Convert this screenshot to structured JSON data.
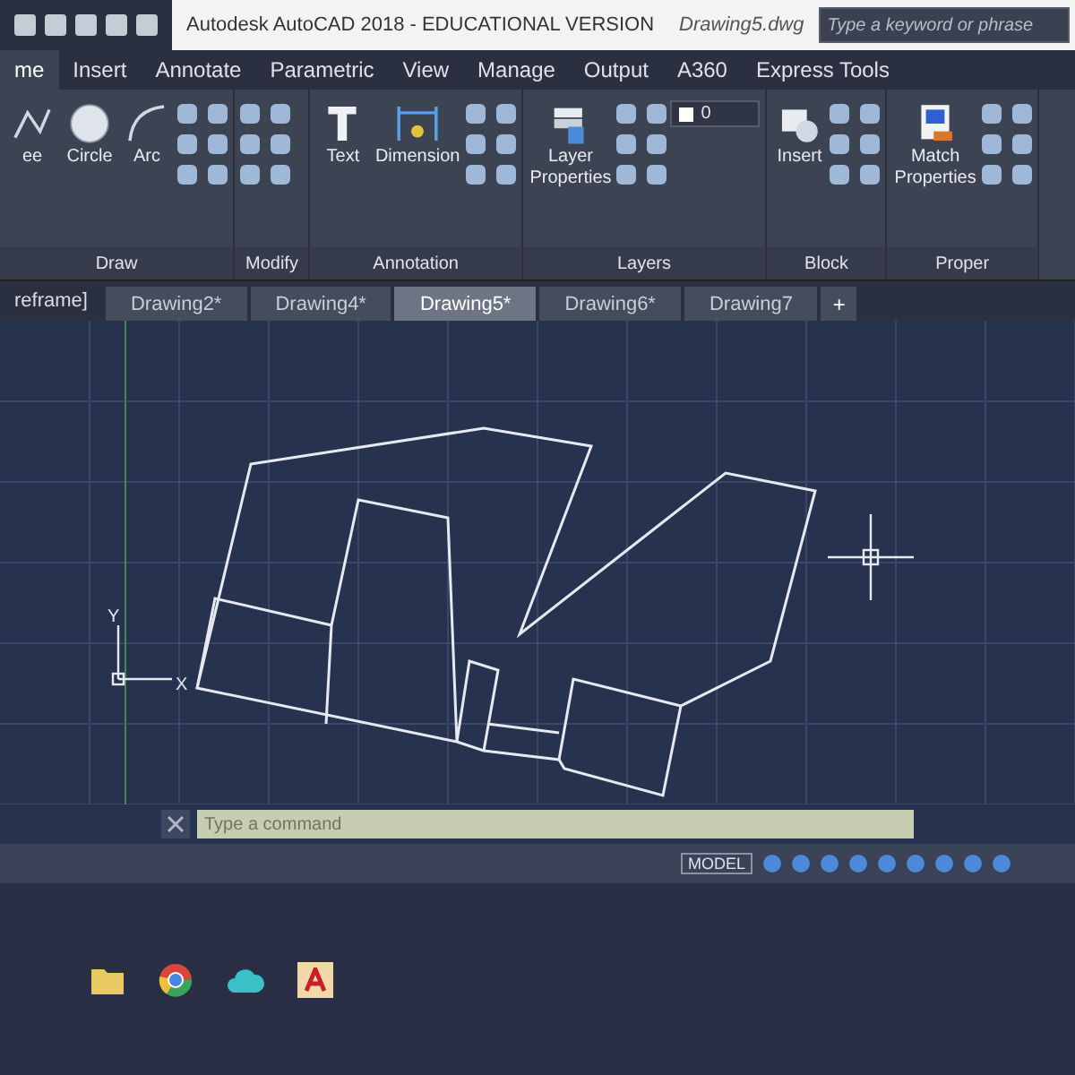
{
  "title_bar": {
    "title": "Autodesk AutoCAD 2018 - EDUCATIONAL VERSION",
    "file": "Drawing5.dwg",
    "search": {
      "placeholder": "Type a keyword or phrase"
    }
  },
  "ribbon_tabs": [
    {
      "label": "me",
      "selected": true
    },
    {
      "label": "Insert",
      "selected": false
    },
    {
      "label": "Annotate",
      "selected": false
    },
    {
      "label": "Parametric",
      "selected": false
    },
    {
      "label": "View",
      "selected": false
    },
    {
      "label": "Manage",
      "selected": false
    },
    {
      "label": "Output",
      "selected": false
    },
    {
      "label": "A360",
      "selected": false
    },
    {
      "label": "Express Tools",
      "selected": false
    }
  ],
  "panels": [
    {
      "title": "Draw",
      "tools": [
        {
          "label": "ee",
          "kind": "polyline"
        },
        {
          "label": "Circle",
          "kind": "circle"
        },
        {
          "label": "Arc",
          "kind": "arc"
        }
      ]
    },
    {
      "title": "Modify"
    },
    {
      "title": "Annotation",
      "tools": [
        {
          "label": "Text",
          "kind": "text"
        },
        {
          "label": "Dimension",
          "kind": "dimension"
        }
      ]
    },
    {
      "title": "Layers",
      "tools": [
        {
          "label": "Layer Properties",
          "kind": "layers"
        }
      ],
      "layer": "0"
    },
    {
      "title": "Block",
      "tools": [
        {
          "label": "Insert",
          "kind": "insert"
        }
      ]
    },
    {
      "title": "Proper",
      "tools": [
        {
          "label": "Match Properties",
          "kind": "match"
        }
      ]
    }
  ],
  "viewport_label": "reframe]",
  "doc_tabs": [
    {
      "label": "Drawing2*",
      "selected": false
    },
    {
      "label": "Drawing4*",
      "selected": false
    },
    {
      "label": "Drawing5*",
      "selected": true
    },
    {
      "label": "Drawing6*",
      "selected": false
    },
    {
      "label": "Drawing7",
      "selected": false
    }
  ],
  "new_tab": "+",
  "ucs": {
    "y": "Y",
    "x": "X"
  },
  "command_line": {
    "placeholder": "Type a command"
  },
  "status_bar": {
    "mode": "MODEL"
  }
}
